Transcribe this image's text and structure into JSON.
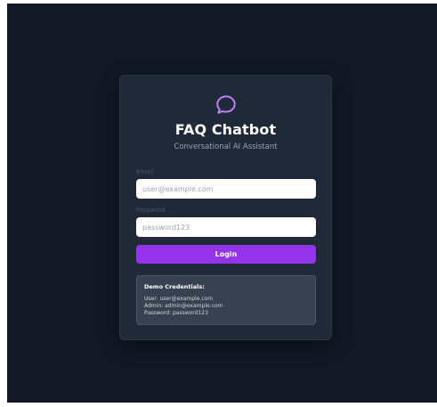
{
  "colors": {
    "page_background": "#121826",
    "card_background": "#1f2937",
    "accent": "#9333ea",
    "logo_stroke": "#c084fc",
    "demo_box_background": "#374151"
  },
  "header": {
    "logo_icon": "chat-bubble-icon",
    "title": "FAQ Chatbot",
    "subtitle": "Conversational AI Assistant"
  },
  "form": {
    "email_label": "Email",
    "email_placeholder": "user@example.com",
    "password_label": "Password",
    "password_placeholder": "password123",
    "login_label": "Login"
  },
  "demo": {
    "title": "Demo Credentials:",
    "lines": [
      "User: user@example.com",
      "Admin: admin@example.com",
      "Password: password123"
    ]
  }
}
